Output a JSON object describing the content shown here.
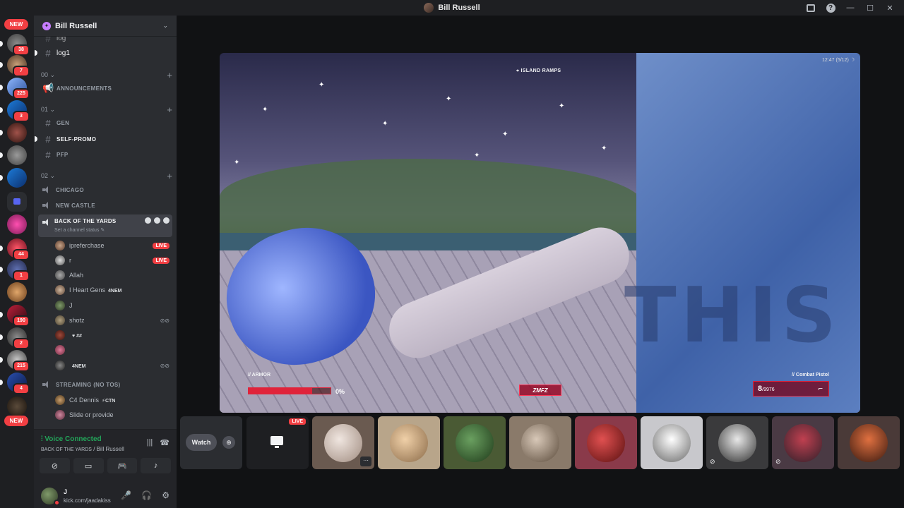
{
  "window": {
    "title": "Bill Russell"
  },
  "rail": {
    "new_top": "NEW",
    "new_bottom": "NEW",
    "badges": [
      "38",
      "7",
      "225",
      "3",
      "44",
      "1",
      "190",
      "2",
      "215",
      "4"
    ]
  },
  "guild": {
    "name": "Bill Russell"
  },
  "channels": {
    "log_partial": "log",
    "log1": "log1",
    "cat00": "00",
    "announcements": "ANNOUNCEMENTS",
    "cat01": "01",
    "gen": "GEN",
    "self_promo": "SELF-PROMO",
    "pfp": "PFP",
    "cat02": "02",
    "chicago": "CHICAGO",
    "new_castle": "NEW CASTLE",
    "back_of_the_yards": "BACK OF THE YARDS",
    "set_status": "Set a channel status",
    "streaming": "STREAMING (NO TOS)"
  },
  "voice_users": [
    {
      "name": "ipreferchase",
      "live": "LIVE"
    },
    {
      "name": "r",
      "live": "LIVE"
    },
    {
      "name": "Allah"
    },
    {
      "name": "I Heart Gens",
      "tag": "4NEM"
    },
    {
      "name": "J"
    },
    {
      "name": "shotz"
    },
    {
      "name": "",
      "tag": "♥ ##"
    },
    {
      "name": ""
    },
    {
      "name": "",
      "tag": "4NEM"
    }
  ],
  "streaming_users": [
    {
      "name": "C4 Dennis",
      "tag": "⚡CTN"
    },
    {
      "name": "Slide or provide"
    }
  ],
  "voice_panel": {
    "title": "Voice Connected",
    "channel": "BACK OF THE YARDS",
    "separator": " / ",
    "server": "Bill Russell"
  },
  "user_panel": {
    "name": "J",
    "status": "kick.com/jaadakiss"
  },
  "stream": {
    "location": "ISLAND RAMPS",
    "clock": "12:47 (5/12) ☽",
    "armor_label": "// ARMOR",
    "armor_value": "0%",
    "armor_fraction": 0.78,
    "weapon_label": "// Combat Pistol",
    "ammo": "8",
    "ammo_reserve": "/9976",
    "logo": "ZMFZ",
    "wall_text": "THIS"
  },
  "strip": {
    "watch_label": "Watch",
    "live_label": "LIVE",
    "more_label": "···"
  },
  "colors": {
    "accent_red": "#f23f43",
    "voice_green": "#23a55a",
    "hud_red": "#e0233a"
  }
}
